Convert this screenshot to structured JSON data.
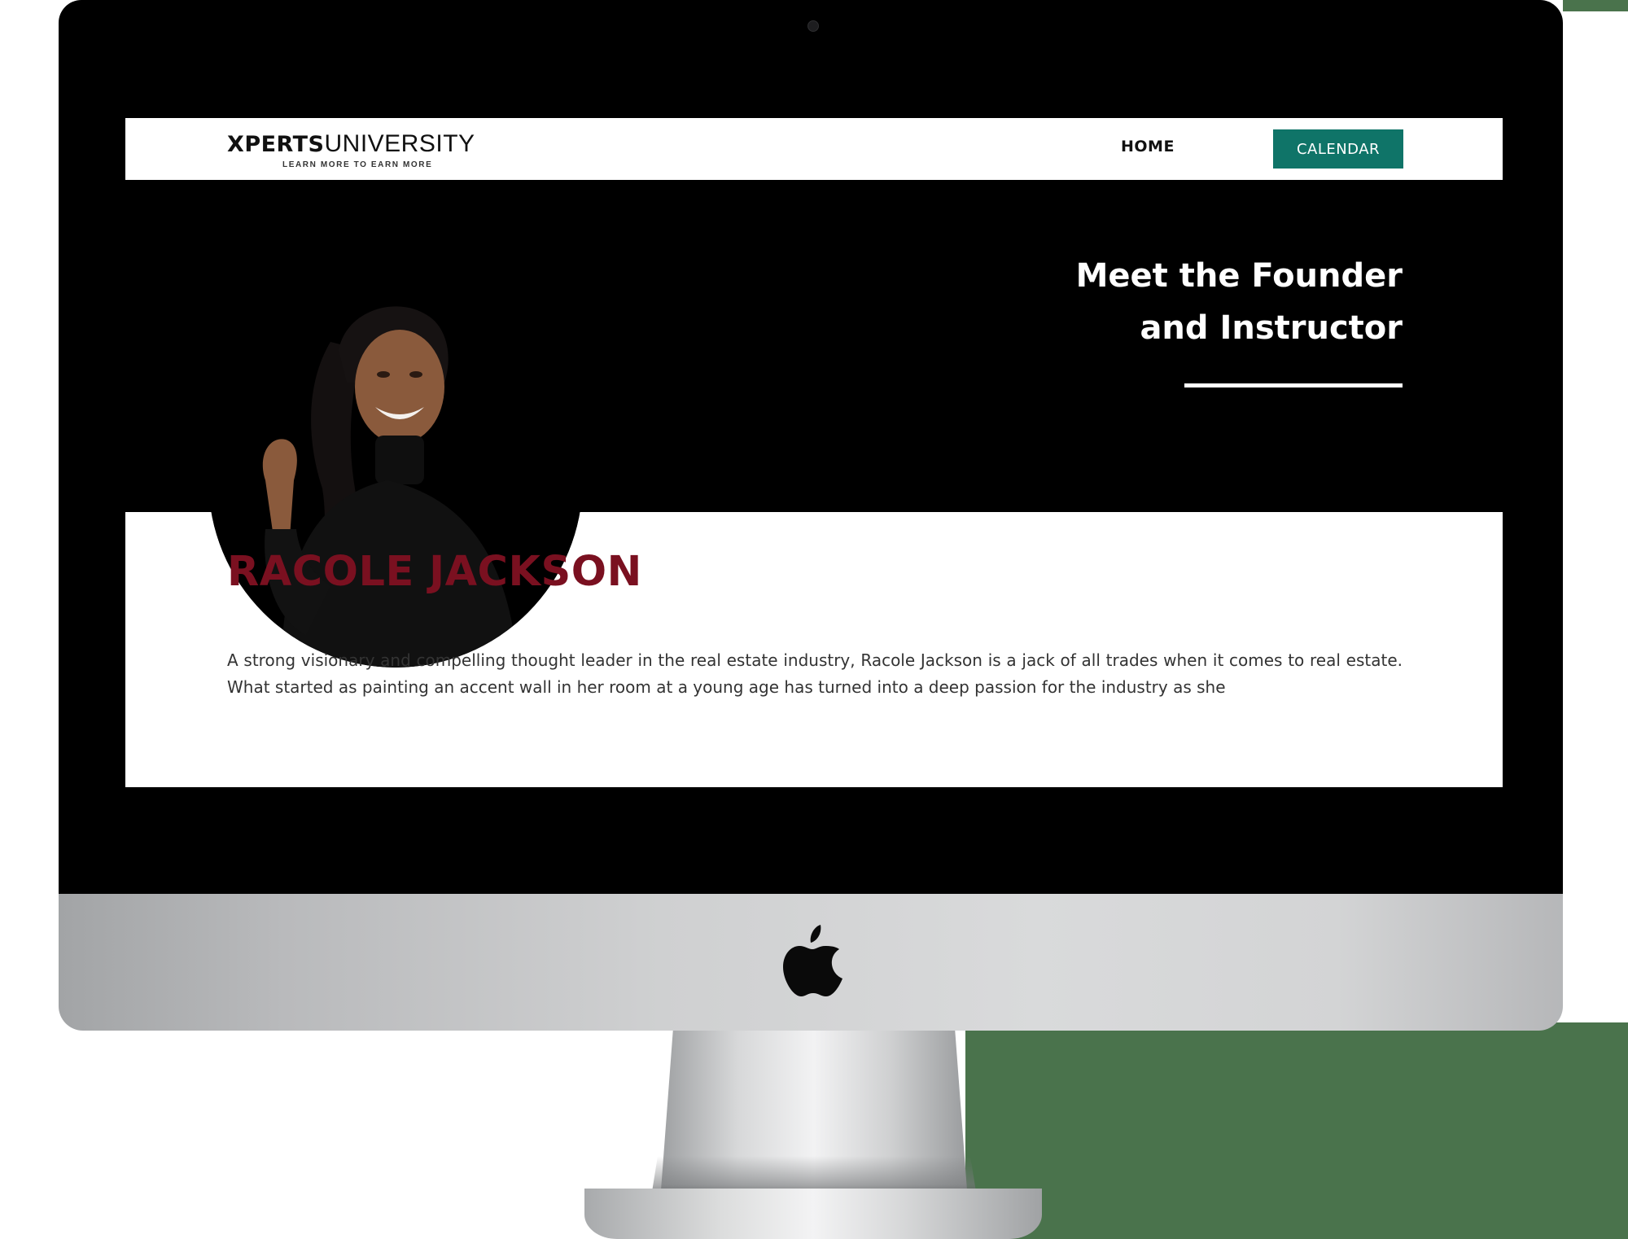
{
  "brand": {
    "name_bold": "XPERTS",
    "name_light": "UNIVERSITY",
    "tagline": "LEARN MORE TO EARN MORE"
  },
  "nav": {
    "home_label": "HOME",
    "calendar_label": "CALENDAR"
  },
  "hero": {
    "title_line1": "Meet the Founder",
    "title_line2": "and Instructor"
  },
  "profile": {
    "name": "RACOLE JACKSON",
    "bio": "A strong visionary and compelling thought leader in the real estate industry, Racole Jackson is a jack of all trades when it comes to real estate. What started as painting an accent wall in her room at a young age has turned into a deep passion for the industry as she"
  },
  "colors": {
    "accent_teal": "#0f7468",
    "name_maroon": "#7a1020",
    "hero_bg": "#000000",
    "bezel": "#000000",
    "background_green": "#4a734c"
  },
  "icons": {
    "device_logo": "apple-logo-icon",
    "camera": "camera-dot"
  }
}
